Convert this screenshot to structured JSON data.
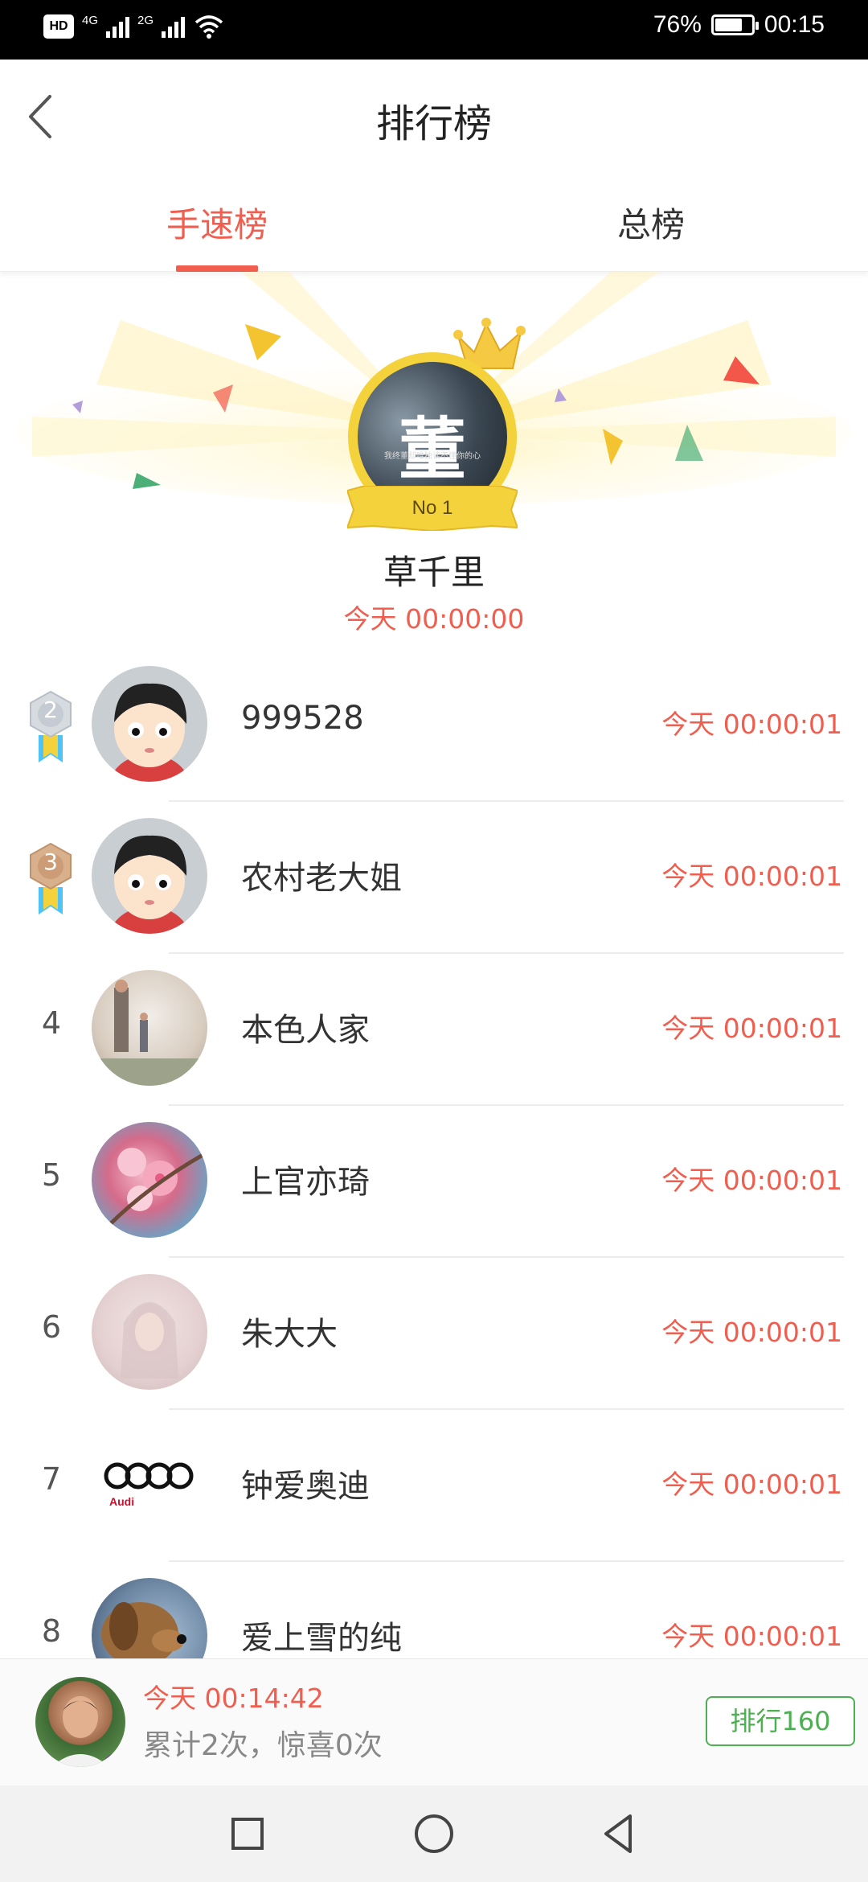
{
  "status_bar": {
    "hd": "HD",
    "net1": "4G",
    "net2": "2G",
    "battery": "76%",
    "battery_level": 0.76,
    "time": "00:15"
  },
  "header": {
    "title": "排行榜"
  },
  "tabs": [
    {
      "label": "手速榜",
      "active": true
    },
    {
      "label": "总榜",
      "active": false
    }
  ],
  "champion": {
    "badge": "No 1",
    "avatar_text": "董",
    "avatar_caption": "我终董却唯独读不懂你的心",
    "name": "草千里",
    "time": "今天 00:00:00"
  },
  "ranking": [
    {
      "rank": "2",
      "name": "999528",
      "time": "今天 00:00:01"
    },
    {
      "rank": "3",
      "name": "农村老大姐",
      "time": "今天 00:00:01"
    },
    {
      "rank": "4",
      "name": "本色人家",
      "time": "今天 00:00:01"
    },
    {
      "rank": "5",
      "name": "上官亦琦",
      "time": "今天 00:00:01"
    },
    {
      "rank": "6",
      "name": "朱大大",
      "time": "今天 00:00:01"
    },
    {
      "rank": "7",
      "name": "钟爱奥迪",
      "time": "今天 00:00:01",
      "avatar_text": "Audi"
    },
    {
      "rank": "8",
      "name": "爱上雪的纯",
      "time": "今天 00:00:01"
    }
  ],
  "my_record": {
    "time": "今天 00:14:42",
    "stats": "累计2次，惊喜0次",
    "rank_button": "排行160"
  },
  "colors": {
    "accent": "#ef5e4f",
    "rank_button": "#4caf50",
    "gold": "#f4d23c"
  }
}
